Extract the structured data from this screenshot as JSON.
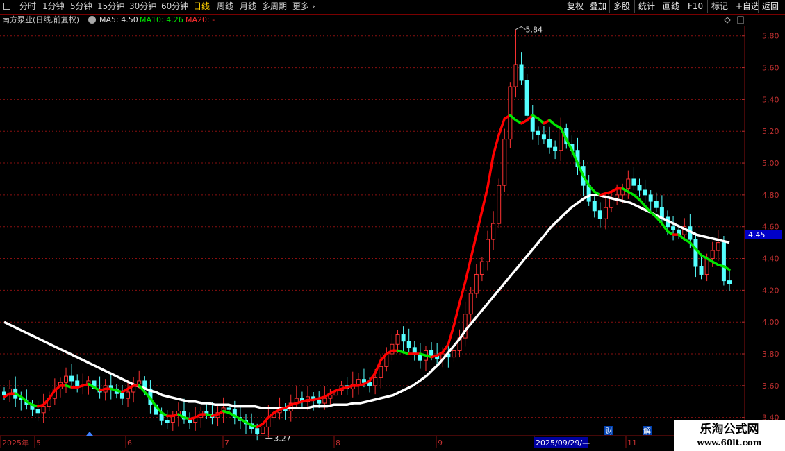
{
  "toolbar": {
    "periods": [
      "分时",
      "1分钟",
      "5分钟",
      "15分钟",
      "30分钟",
      "60分钟",
      "日线",
      "周线",
      "月线",
      "多周期",
      "更多"
    ],
    "active_period": "日线",
    "buttons": [
      "复权",
      "叠加",
      "多股",
      "统计",
      "画线",
      "F10",
      "标记",
      "+自选",
      "返回"
    ],
    "square_icon": "square-box-icon"
  },
  "legend": {
    "stock": "南方泵业(日线,前复权)",
    "ma5": "MA5: 4.50",
    "ma10": "MA10: 4.26",
    "ma20": "MA20: -",
    "ma_icon": "settings-circle-icon"
  },
  "colors": {
    "up": "#ff3232",
    "down": "#54ffff",
    "ma_rising": "#ff0000",
    "ma_falling": "#00e600",
    "ma_long": "#ffffff",
    "grid": "#8a1010",
    "axis_text": "#c03030",
    "price_tag_bg": "#0000c8"
  },
  "chart_data": {
    "type": "candlestick",
    "y_ticks": [
      "5.80",
      "5.60",
      "5.40",
      "5.20",
      "5.00",
      "4.80",
      "4.60",
      "4.40",
      "4.20",
      "4.00",
      "3.80",
      "3.60",
      "3.40"
    ],
    "ylim": [
      3.32,
      5.86
    ],
    "grid": true,
    "price_tag": "4.45",
    "high_label": "5.84",
    "low_label": "3.27",
    "x_labels": [
      "2025年",
      "5",
      "6",
      "7",
      "8",
      "9",
      "2025/09/29/—",
      "11"
    ],
    "markers": [
      "财",
      "解"
    ],
    "bars_count": 130,
    "candles": {
      "open": [
        3.56,
        3.54,
        3.58,
        3.52,
        3.51,
        3.48,
        3.45,
        3.43,
        3.47,
        3.52,
        3.58,
        3.62,
        3.66,
        3.63,
        3.6,
        3.61,
        3.63,
        3.58,
        3.56,
        3.6,
        3.58,
        3.55,
        3.52,
        3.56,
        3.61,
        3.63,
        3.58,
        3.48,
        3.42,
        3.38,
        3.37,
        3.41,
        3.44,
        3.39,
        3.37,
        3.4,
        3.44,
        3.42,
        3.4,
        3.43,
        3.46,
        3.45,
        3.4,
        3.38,
        3.36,
        3.33,
        3.3,
        3.34,
        3.4,
        3.43,
        3.46,
        3.44,
        3.49,
        3.52,
        3.5,
        3.53,
        3.51,
        3.49,
        3.52,
        3.54,
        3.57,
        3.6,
        3.58,
        3.61,
        3.64,
        3.62,
        3.6,
        3.65,
        3.72,
        3.8,
        3.86,
        3.92,
        3.88,
        3.84,
        3.8,
        3.76,
        3.82,
        3.79,
        3.77,
        3.8,
        3.78,
        3.82,
        3.9,
        4.05,
        4.18,
        4.3,
        4.38,
        4.52,
        4.62,
        4.86,
        5.15,
        5.48,
        5.62,
        5.52,
        5.3,
        5.2,
        5.18,
        5.15,
        5.1,
        5.08,
        5.22,
        5.12,
        5.08,
        4.98,
        4.86,
        4.76,
        4.7,
        4.65,
        4.72,
        4.78,
        4.8,
        4.84,
        4.9,
        4.86,
        4.83,
        4.8,
        4.76,
        4.72,
        4.66,
        4.6,
        4.58,
        4.55,
        4.6,
        4.52,
        4.35,
        4.3,
        4.4,
        4.45,
        4.5,
        4.26
      ],
      "close": [
        3.54,
        3.58,
        3.52,
        3.51,
        3.48,
        3.45,
        3.43,
        3.47,
        3.52,
        3.58,
        3.62,
        3.66,
        3.63,
        3.6,
        3.61,
        3.63,
        3.58,
        3.56,
        3.6,
        3.58,
        3.55,
        3.52,
        3.56,
        3.61,
        3.63,
        3.58,
        3.48,
        3.42,
        3.38,
        3.37,
        3.41,
        3.44,
        3.39,
        3.37,
        3.4,
        3.44,
        3.42,
        3.4,
        3.43,
        3.46,
        3.45,
        3.4,
        3.38,
        3.36,
        3.33,
        3.3,
        3.34,
        3.4,
        3.43,
        3.46,
        3.44,
        3.49,
        3.52,
        3.5,
        3.53,
        3.51,
        3.49,
        3.52,
        3.54,
        3.57,
        3.6,
        3.58,
        3.61,
        3.64,
        3.62,
        3.6,
        3.65,
        3.72,
        3.8,
        3.86,
        3.92,
        3.88,
        3.84,
        3.8,
        3.76,
        3.82,
        3.79,
        3.77,
        3.8,
        3.78,
        3.82,
        3.9,
        4.05,
        4.18,
        4.3,
        4.38,
        4.52,
        4.62,
        4.86,
        5.15,
        5.48,
        5.62,
        5.52,
        5.3,
        5.2,
        5.18,
        5.15,
        5.1,
        5.08,
        5.22,
        5.12,
        5.08,
        4.98,
        4.86,
        4.76,
        4.7,
        4.65,
        4.72,
        4.78,
        4.8,
        4.84,
        4.9,
        4.86,
        4.83,
        4.8,
        4.76,
        4.72,
        4.66,
        4.6,
        4.58,
        4.55,
        4.6,
        4.52,
        4.35,
        4.3,
        4.4,
        4.45,
        4.5,
        4.26,
        4.24
      ],
      "high_extremes": {
        "91": 5.84,
        "46": 3.27
      },
      "low_extremes": {
        "46": 3.27
      }
    },
    "series": [
      {
        "role": "short_ma",
        "values": [
          3.53,
          3.55,
          3.55,
          3.53,
          3.5,
          3.48,
          3.47,
          3.48,
          3.52,
          3.57,
          3.6,
          3.6,
          3.59,
          3.59,
          3.6,
          3.61,
          3.59,
          3.57,
          3.58,
          3.58,
          3.57,
          3.56,
          3.58,
          3.6,
          3.6,
          3.56,
          3.52,
          3.47,
          3.43,
          3.41,
          3.41,
          3.42,
          3.4,
          3.39,
          3.4,
          3.42,
          3.42,
          3.41,
          3.42,
          3.44,
          3.43,
          3.41,
          3.39,
          3.37,
          3.35,
          3.34,
          3.36,
          3.4,
          3.43,
          3.45,
          3.46,
          3.48,
          3.49,
          3.5,
          3.51,
          3.51,
          3.52,
          3.53,
          3.55,
          3.57,
          3.58,
          3.59,
          3.6,
          3.6,
          3.61,
          3.63,
          3.68,
          3.76,
          3.8,
          3.82,
          3.82,
          3.81,
          3.8,
          3.8,
          3.8,
          3.79,
          3.78,
          3.79,
          3.81,
          3.86,
          3.98,
          4.12,
          4.25,
          4.4,
          4.55,
          4.7,
          4.85,
          5.05,
          5.18,
          5.28,
          5.3,
          5.27,
          5.25,
          5.27,
          5.3,
          5.28,
          5.25,
          5.27,
          5.24,
          5.22,
          5.15,
          5.08,
          5.0,
          4.92,
          4.86,
          4.82,
          4.8,
          4.81,
          4.82,
          4.84,
          4.84,
          4.82,
          4.8,
          4.77,
          4.73,
          4.69,
          4.66,
          4.62,
          4.57,
          4.55,
          4.55,
          4.52,
          4.5,
          4.46,
          4.42,
          4.4,
          4.38,
          4.36,
          4.35,
          4.33
        ]
      },
      {
        "role": "long_ma",
        "values": [
          4.0,
          3.98,
          3.96,
          3.94,
          3.92,
          3.9,
          3.88,
          3.86,
          3.84,
          3.82,
          3.8,
          3.78,
          3.76,
          3.74,
          3.72,
          3.7,
          3.68,
          3.66,
          3.64,
          3.62,
          3.6,
          3.59,
          3.57,
          3.56,
          3.54,
          3.53,
          3.52,
          3.51,
          3.5,
          3.5,
          3.49,
          3.49,
          3.48,
          3.48,
          3.48,
          3.47,
          3.47,
          3.47,
          3.47,
          3.46,
          3.46,
          3.46,
          3.46,
          3.46,
          3.46,
          3.46,
          3.46,
          3.47,
          3.47,
          3.47,
          3.48,
          3.48,
          3.48,
          3.49,
          3.49,
          3.5,
          3.51,
          3.52,
          3.53,
          3.54,
          3.56,
          3.58,
          3.6,
          3.63,
          3.66,
          3.7,
          3.74,
          3.79,
          3.84,
          3.89,
          3.95,
          4.0,
          4.05,
          4.1,
          4.15,
          4.2,
          4.25,
          4.3,
          4.35,
          4.4,
          4.45,
          4.5,
          4.55,
          4.6,
          4.64,
          4.68,
          4.72,
          4.75,
          4.78,
          4.8,
          4.8,
          4.79,
          4.78,
          4.77,
          4.76,
          4.75,
          4.73,
          4.71,
          4.69,
          4.67,
          4.65,
          4.63,
          4.61,
          4.59,
          4.57,
          4.55,
          4.54,
          4.53,
          4.52,
          4.51,
          4.5
        ]
      }
    ]
  },
  "watermark": {
    "line1": "乐淘公式网",
    "line2": "www.60lt.com"
  }
}
